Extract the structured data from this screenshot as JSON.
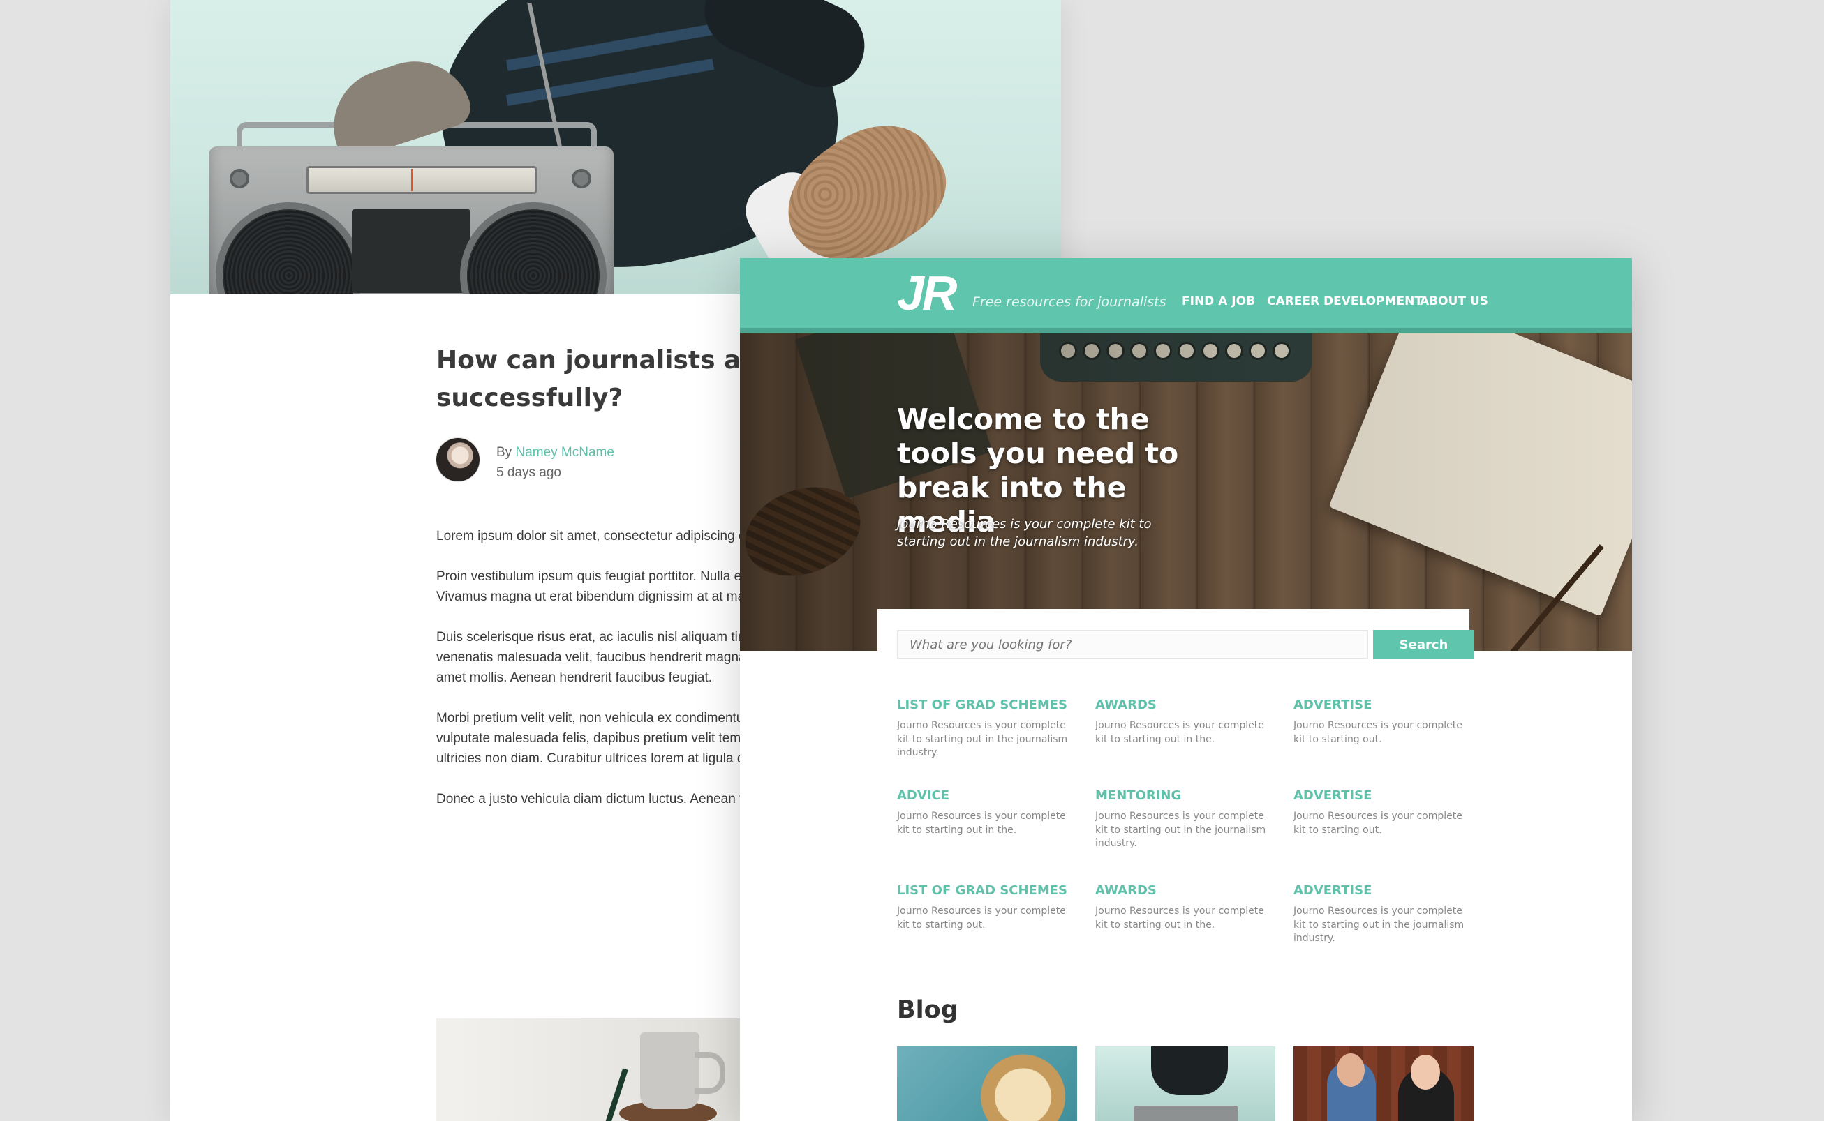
{
  "article": {
    "title": "How can journalists and PR work together successfully?",
    "author_prefix": "By",
    "author_name": "Namey McName",
    "posted": "5 days ago",
    "paragraphs": [
      "Lorem ipsum dolor sit amet, consectetur adipiscing elit. Quisque malesuada hendrerit dictum.",
      "Proin vestibulum ipsum quis feugiat porttitor. Nulla elementum sapien, fermentum ullamcorper leo. Vivamus magna ut erat bibendum dignissim at at mauris.",
      "Duis scelerisque risus erat, ac iaculis nisl aliquam tincidunt. Duis pulvinar faucibus elit. Maecenas venenatis malesuada velit, faucibus hendrerit magna condimentum ac. Suspendisse ultrices luctus nisi sit amet mollis. Aenean hendrerit faucibus feugiat.",
      "Morbi pretium velit velit, non vehicula ex condimentum. Integer ut sapien ut dolor blandit cursus. Quisque vulputate malesuada felis, dapibus pretium velit tempus vitae. Pellentesque quis erat non nunc interdum ultricies non diam. Curabitur ultrices lorem at ligula dapibus, et tempus enim feugiat.",
      "Donec a justo vehicula diam dictum luctus. Aenean vel ac ligula maximus tincidunt in at felis."
    ]
  },
  "site": {
    "logo": "JR",
    "tagline": "Free resources for journalists",
    "nav": [
      "FIND A JOB",
      "CAREER DEVELOPMENT",
      "ABOUT US"
    ],
    "accent_color": "#5fc5ac"
  },
  "hero": {
    "heading": "Welcome to the tools you need to break into the media",
    "subtext": "Journo Resources is your complete kit to starting out in the journalism industry."
  },
  "search": {
    "placeholder": "What are you looking for?",
    "button": "Search"
  },
  "categories": [
    {
      "title": "LIST OF GRAD SCHEMES",
      "desc": "Journo Resources is your complete kit to starting out in the journalism industry."
    },
    {
      "title": "AWARDS",
      "desc": "Journo Resources is your complete kit to starting out in the."
    },
    {
      "title": "ADVERTISE",
      "desc": "Journo Resources is your complete kit to starting out."
    },
    {
      "title": "ADVICE",
      "desc": "Journo Resources is your complete kit to starting out in the."
    },
    {
      "title": "MENTORING",
      "desc": "Journo Resources is your complete kit to starting out in the journalism industry."
    },
    {
      "title": "ADVERTISE",
      "desc": "Journo Resources is your complete kit to starting out."
    },
    {
      "title": "LIST OF GRAD SCHEMES",
      "desc": "Journo Resources is your complete kit to starting out."
    },
    {
      "title": "AWARDS",
      "desc": "Journo Resources is your complete kit to starting out in the."
    },
    {
      "title": "ADVERTISE",
      "desc": "Journo Resources is your complete kit to starting out in the journalism industry."
    }
  ],
  "blog": {
    "heading": "Blog"
  }
}
